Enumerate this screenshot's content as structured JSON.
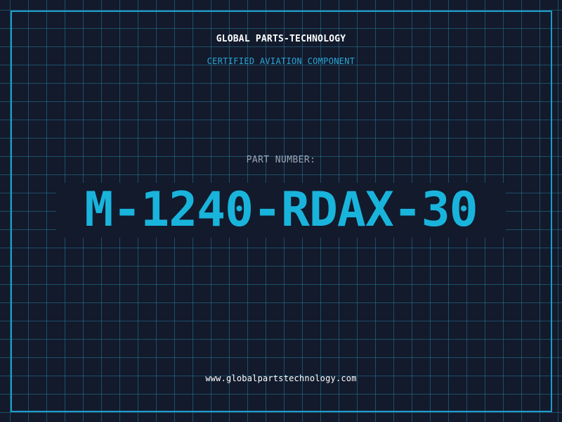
{
  "header": {
    "company": "GLOBAL PARTS-TECHNOLOGY",
    "tagline": "CERTIFIED AVIATION COMPONENT"
  },
  "part": {
    "label": "PART NUMBER:",
    "number": "M-1240-RDAX-30"
  },
  "footer": {
    "website": "www.globalpartstechnology.com"
  },
  "colors": {
    "background": "#121a2c",
    "grid": "#26789a",
    "frame": "#1f9cc7",
    "accent": "#19b4dc",
    "label": "#9aa6b6",
    "text": "#ffffff"
  }
}
